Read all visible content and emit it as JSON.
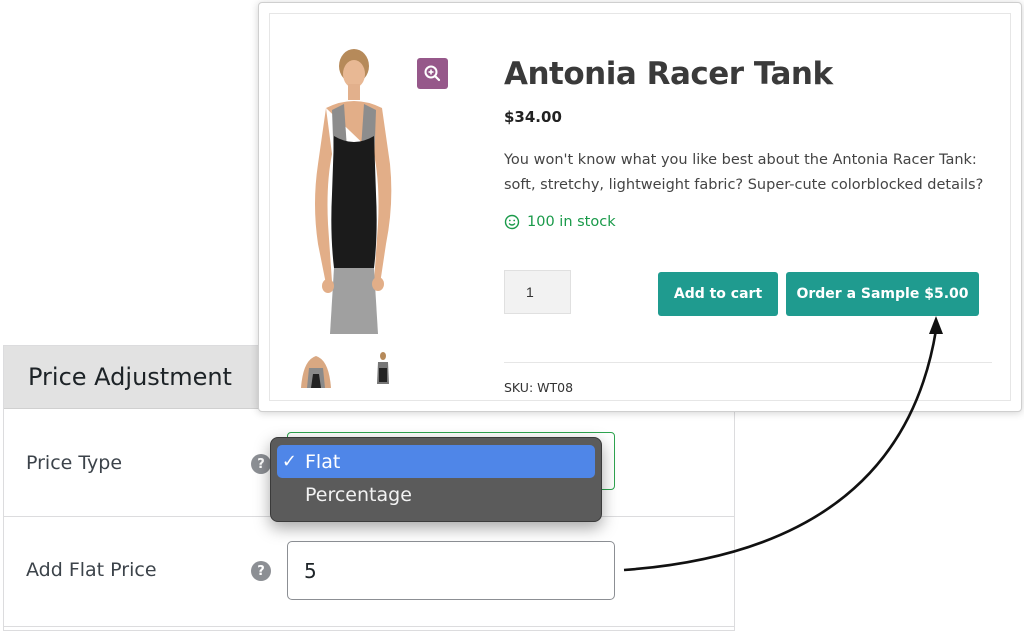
{
  "product": {
    "title": "Antonia Racer Tank",
    "price": "$34.00",
    "description": "You won't know what you like best about the Antonia Racer Tank: soft, stretchy, lightweight fabric? Super-cute colorblocked details?",
    "stock": "100 in stock",
    "quantity": "1",
    "add_to_cart_label": "Add to cart",
    "sample_button_label": "Order a Sample $5.00",
    "sku": "SKU: WT08",
    "accent_color": "#1f9b8f",
    "zoom_color": "#96588a"
  },
  "admin": {
    "section_title": "Price Adjustment",
    "price_type_label": "Price Type",
    "flat_price_label": "Add Flat Price",
    "flat_price_value": "5",
    "help_icon": "?",
    "dropdown": {
      "options": [
        {
          "label": "Flat",
          "selected": true
        },
        {
          "label": "Percentage",
          "selected": false
        }
      ],
      "check_mark": "✓"
    }
  }
}
